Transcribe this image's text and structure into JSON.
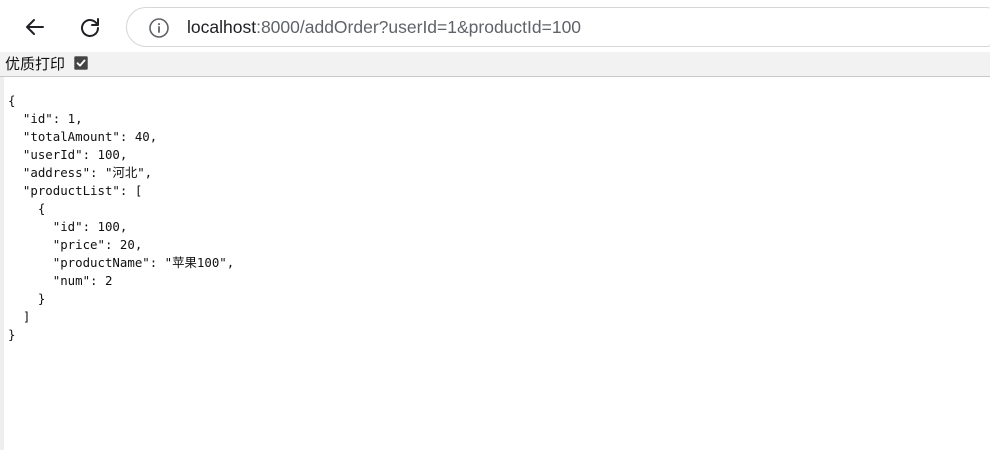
{
  "browser": {
    "url_host": "localhost",
    "url_rest": ":8000/addOrder?userId=1&productId=100"
  },
  "print_bar": {
    "label": "优质打印",
    "checked": true
  },
  "json_text": "{\n  \"id\": 1,\n  \"totalAmount\": 40,\n  \"userId\": 100,\n  \"address\": \"河北\",\n  \"productList\": [\n    {\n      \"id\": 100,\n      \"price\": 20,\n      \"productName\": \"苹果100\",\n      \"num\": 2\n    }\n  ]\n}"
}
